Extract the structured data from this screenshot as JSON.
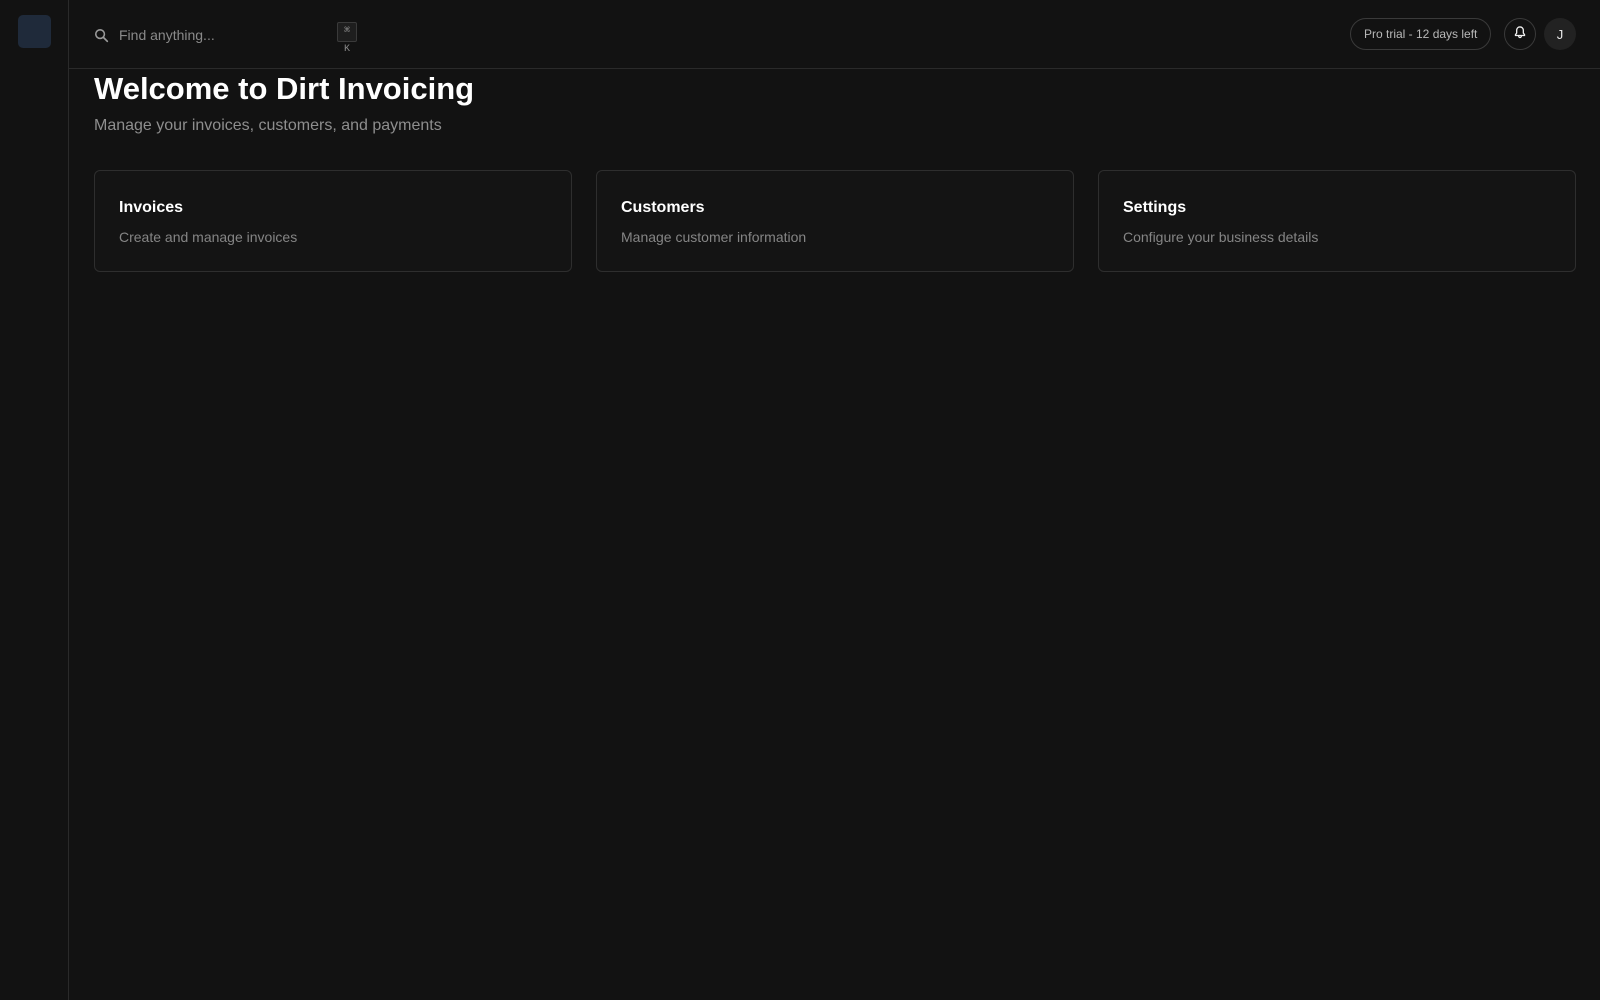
{
  "search": {
    "placeholder": "Find anything...",
    "shortcut": "⌘ K"
  },
  "header": {
    "trial_label": "Pro trial - 12 days left",
    "avatar_initial": "J"
  },
  "main": {
    "title": "Welcome to Dirt Invoicing",
    "subtitle": "Manage your invoices, customers, and payments",
    "cards": [
      {
        "title": "Invoices",
        "description": "Create and manage invoices"
      },
      {
        "title": "Customers",
        "description": "Manage customer information"
      },
      {
        "title": "Settings",
        "description": "Configure your business details"
      }
    ]
  },
  "colors": {
    "background": "#121212",
    "border": "#2a2a2a",
    "logo": "#1f2a3a",
    "muted_text": "#8e8e8e"
  },
  "icons": {
    "search": "search-icon",
    "notifications": "bell-icon"
  }
}
